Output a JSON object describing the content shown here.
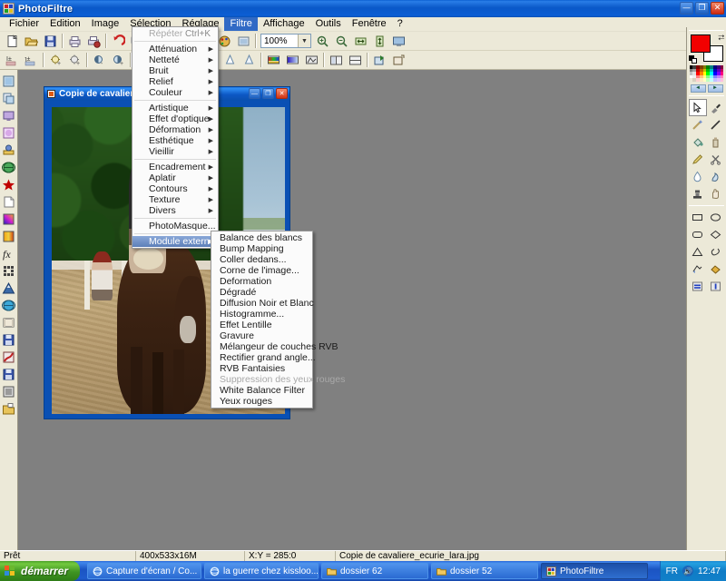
{
  "window": {
    "title": "PhotoFiltre",
    "icon": "photofiltre-icon",
    "buttons": {
      "minimize": "_",
      "maximize": "□",
      "close": "✕"
    }
  },
  "menubar": {
    "items": [
      {
        "label": "Fichier",
        "active": false
      },
      {
        "label": "Edition",
        "active": false
      },
      {
        "label": "Image",
        "active": false
      },
      {
        "label": "Sélection",
        "active": false
      },
      {
        "label": "Réglage",
        "active": false
      },
      {
        "label": "Filtre",
        "active": true
      },
      {
        "label": "Affichage",
        "active": false
      },
      {
        "label": "Outils",
        "active": false
      },
      {
        "label": "Fenêtre",
        "active": false
      },
      {
        "label": "?",
        "active": false
      }
    ]
  },
  "toolbar": {
    "zoom_value": "100%",
    "zoom_dropdown_arrow": "▼",
    "row1_icons": [
      "new-document-icon",
      "open-folder-icon",
      "save-icon",
      "print-icon",
      "print-preview-icon",
      "undo-icon",
      "redo-icon",
      "selection-icon",
      "paste-icon",
      "copy-icon",
      "crop-icon",
      "resize-icon",
      "rotate-left-icon",
      "rotate-right-icon",
      "flip-horizontal-icon",
      "flip-vertical-icon",
      "text-tool-icon",
      "layer-icon",
      "palette-icon",
      "frame-icon",
      "zoom-in-icon",
      "zoom-out-icon",
      "fit-width-icon",
      "fit-height-icon",
      "full-screen-icon"
    ],
    "row2_icons": [
      "brightness-plus-icon",
      "brightness-minus-icon",
      "contrast-plus-icon",
      "contrast-minus-icon",
      "gamma-plus-icon",
      "gamma-minus-icon",
      "saturation-plus-icon",
      "saturation-minus-icon",
      "blur-icon",
      "blur-more-icon",
      "sharpen-icon",
      "sharpen-more-icon",
      "rgb-histogram-icon",
      "gradient-icon",
      "grayscale-icon",
      "mirror-icon",
      "split-icon",
      "export-icon",
      "batch-icon"
    ]
  },
  "left_toolbar": {
    "icons": [
      "image-icon",
      "copy-image-icon",
      "screen-capture-icon",
      "mask-icon",
      "stamp-icon",
      "sphere-icon",
      "star-icon",
      "page-curl-icon",
      "gradient-fill-icon",
      "color-bars-icon",
      "effects-fx-icon",
      "pattern-icon",
      "mountain-icon",
      "globe-icon",
      "film-icon",
      "save-as-icon",
      "red-filter-icon",
      "save-all-icon",
      "frame-tool-icon",
      "batch-folder-icon"
    ]
  },
  "palette": {
    "foreground_color": "#f20000",
    "background_color": "#ffffff",
    "swap_icon": "swap-colors-icon",
    "reset_icon": "reset-colors-icon",
    "prev_label": "◄",
    "next_label": "►",
    "tools": [
      "pointer-select-icon",
      "eyedropper-icon",
      "magic-wand-icon",
      "line-icon",
      "paint-bucket-icon",
      "spray-can-icon",
      "pencil-icon",
      "scissors-icon",
      "water-drop-icon",
      "smudge-icon",
      "stamp-tool-icon",
      "hand-icon"
    ],
    "shapes": [
      "rectangle-icon",
      "ellipse-icon",
      "rounded-rectangle-icon",
      "diamond-icon",
      "triangle-icon",
      "lasso-icon",
      "polygon-icon",
      "fill-shape-icon",
      "align-horizontal-icon",
      "align-vertical-icon"
    ]
  },
  "menu_filtre": {
    "name": "Filtre",
    "items": [
      {
        "label": "Répéter",
        "shortcut": "Ctrl+K",
        "disabled": true,
        "submenu": false
      },
      {
        "separator": true
      },
      {
        "label": "Atténuation",
        "submenu": true
      },
      {
        "label": "Netteté",
        "submenu": true
      },
      {
        "label": "Bruit",
        "submenu": true
      },
      {
        "label": "Relief",
        "submenu": true
      },
      {
        "label": "Couleur",
        "submenu": true
      },
      {
        "separator": true
      },
      {
        "label": "Artistique",
        "submenu": true
      },
      {
        "label": "Effet d'optique",
        "submenu": true
      },
      {
        "label": "Déformation",
        "submenu": true
      },
      {
        "label": "Esthétique",
        "submenu": true
      },
      {
        "label": "Vieillir",
        "submenu": true
      },
      {
        "separator": true
      },
      {
        "label": "Encadrement",
        "submenu": true
      },
      {
        "label": "Aplatir",
        "submenu": true
      },
      {
        "label": "Contours",
        "submenu": true
      },
      {
        "label": "Texture",
        "submenu": true
      },
      {
        "label": "Divers",
        "submenu": true
      },
      {
        "separator": true
      },
      {
        "label": "PhotoMasque...",
        "submenu": false
      },
      {
        "separator": true
      },
      {
        "label": "Module externe",
        "submenu": true,
        "highlighted": true
      }
    ]
  },
  "menu_module_externe": {
    "name": "Module externe",
    "items": [
      {
        "label": "Balance des blancs"
      },
      {
        "label": "Bump Mapping"
      },
      {
        "label": "Coller dedans..."
      },
      {
        "label": "Corne de l'image..."
      },
      {
        "label": "Deformation"
      },
      {
        "label": "Dégradé"
      },
      {
        "label": "Diffusion Noir et Blanc"
      },
      {
        "label": "Histogramme..."
      },
      {
        "label": "Effet Lentille"
      },
      {
        "label": "Gravure"
      },
      {
        "label": "Mélangeur de couches RVB"
      },
      {
        "label": "Rectifier grand angle..."
      },
      {
        "label": "RVB Fantaisies"
      },
      {
        "label": "Suppression des yeux rouges",
        "disabled": true
      },
      {
        "label": "White Balance Filter"
      },
      {
        "label": "Yeux rouges"
      }
    ]
  },
  "document": {
    "title": "Copie de cavaliere_e",
    "full_title": "Copie de cavaliere_ecurie_lara.jpg",
    "buttons": {
      "minimize": "_",
      "maximize": "□",
      "close": "✕"
    }
  },
  "statusbar": {
    "state": "Prêt",
    "dimensions": "400x533x16M",
    "coordinates": "X:Y = 285:0",
    "filename": "Copie de cavaliere_ecurie_lara.jpg"
  },
  "taskbar": {
    "start_label": "démarrer",
    "tasks": [
      {
        "label": "Capture d'écran / Co...",
        "icon": "internet-explorer-icon",
        "active": false
      },
      {
        "label": "la guerre chez kissloo...",
        "icon": "internet-explorer-icon",
        "active": false
      },
      {
        "label": "dossier 62",
        "icon": "folder-icon",
        "active": false
      },
      {
        "label": "dossier 52",
        "icon": "folder-icon",
        "active": false
      },
      {
        "label": "PhotoFiltre",
        "icon": "photofiltre-icon",
        "active": true
      }
    ],
    "tray": {
      "language": "FR",
      "volume_icon": "volume-icon",
      "clock": "12:47"
    }
  }
}
